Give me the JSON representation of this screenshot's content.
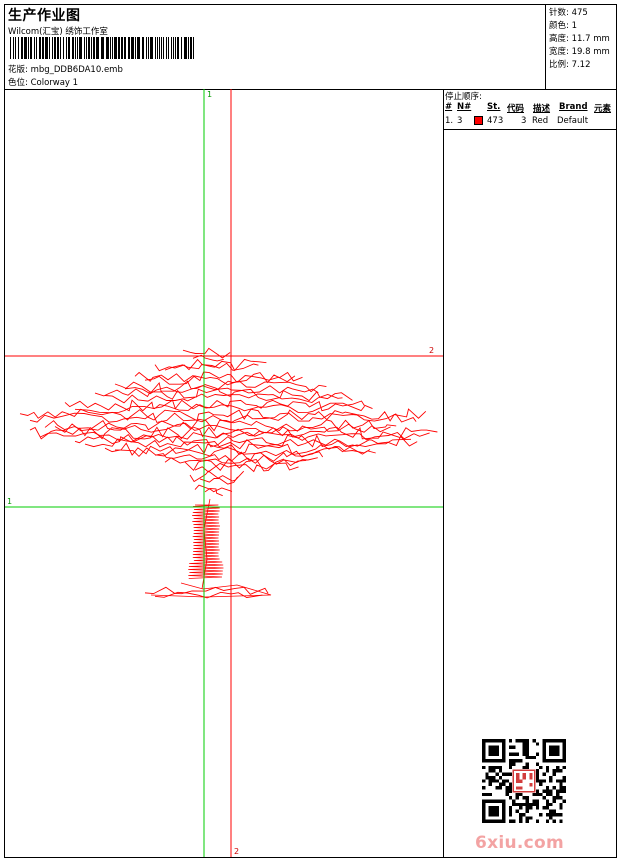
{
  "header": {
    "title": "生产作业图",
    "company": "Wilcom(汇宝) 绣饰工作室",
    "design": "花版: mbg_DDB6DA10.emb",
    "colorway": "色位: Colorway 1"
  },
  "stats": {
    "stitches": "针数: 475",
    "colors": "颜色: 1",
    "height": "高度: 11.7 mm",
    "width": "宽度: 19.8 mm",
    "scale": "比例: 7.12"
  },
  "stop_sequence": {
    "label": "停止顺序:",
    "headers": [
      "#",
      "N#",
      "St.",
      "代码",
      "描述",
      "Brand",
      "元素"
    ],
    "rows": [
      {
        "index": "1.",
        "needle": "3",
        "stitches": "473",
        "code": "3",
        "description": "Red",
        "brand": "Default",
        "color": "#ff0000"
      }
    ]
  },
  "guides": {
    "v1": "1",
    "v2": "2",
    "h1": "1",
    "h2": "2"
  },
  "colors": {
    "stitch": "#ff0000",
    "guide_green": "#00cc00",
    "guide_red": "#ff0000"
  },
  "icons": [
    "barcode-icon",
    "qr-code-icon",
    "seal-stamp-icon"
  ],
  "watermark": "6xiu.com"
}
